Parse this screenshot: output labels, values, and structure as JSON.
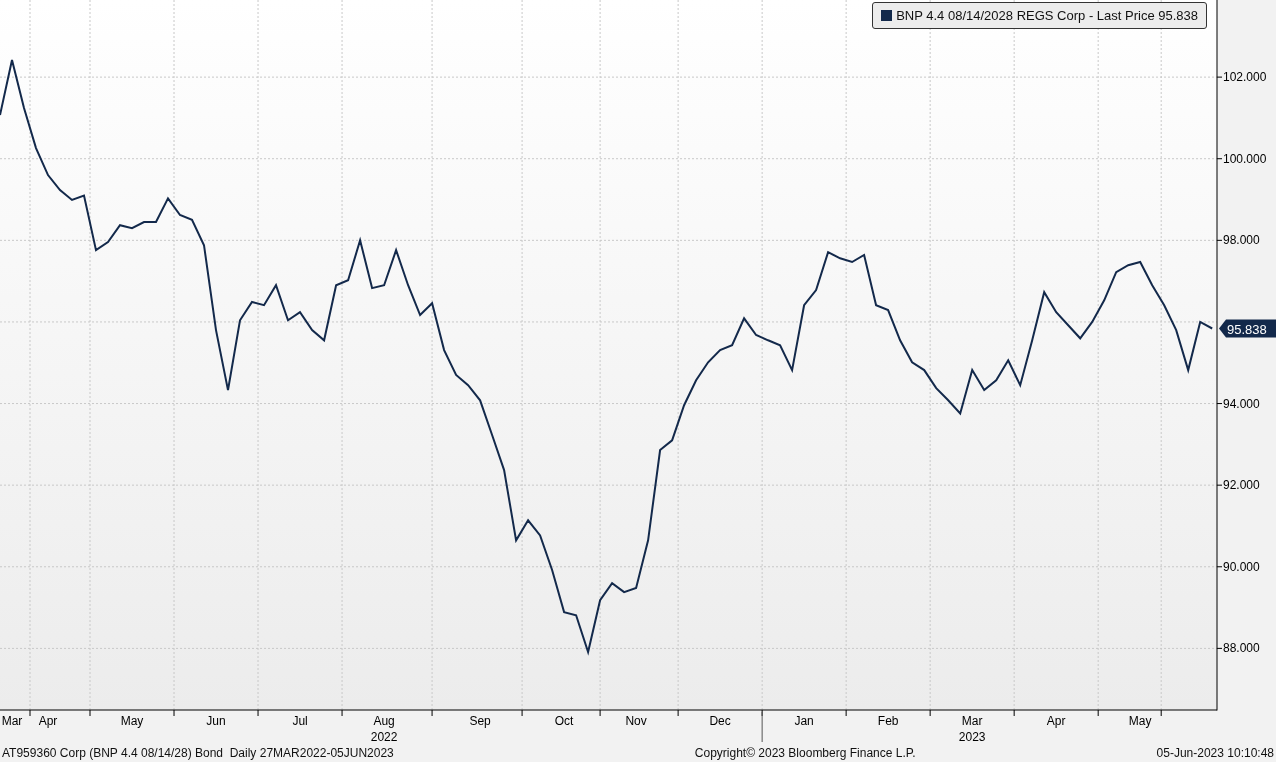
{
  "chart": {
    "last_price": "95.838",
    "year_labels": [
      {
        "label": "2022"
      },
      {
        "label": "2023"
      }
    ],
    "chart_data": {
      "type": "line",
      "grid": true,
      "ylim": [
        86.49,
        103.89
      ],
      "categories": [
        null,
        "Mar",
        null,
        null,
        "Apr",
        null,
        null,
        null,
        null,
        null,
        null,
        "May",
        null,
        null,
        null,
        null,
        null,
        null,
        "Jun",
        null,
        null,
        null,
        null,
        null,
        null,
        "Jul",
        null,
        null,
        null,
        null,
        null,
        null,
        "Aug",
        null,
        null,
        null,
        null,
        null,
        null,
        null,
        "Sep",
        null,
        null,
        null,
        null,
        null,
        null,
        "Oct",
        null,
        null,
        null,
        null,
        null,
        "Nov",
        null,
        null,
        null,
        null,
        null,
        null,
        "Dec",
        null,
        null,
        null,
        null,
        null,
        null,
        "Jan",
        null,
        null,
        null,
        null,
        null,
        null,
        "Feb",
        null,
        null,
        null,
        null,
        null,
        null,
        "Mar",
        null,
        null,
        null,
        null,
        null,
        null,
        "Apr",
        null,
        null,
        null,
        null,
        null,
        null,
        "May",
        null,
        null,
        null,
        null,
        null,
        null
      ],
      "yticks": [
        {
          "value": 88,
          "label": "88.000"
        },
        {
          "value": 90,
          "label": "90.000"
        },
        {
          "value": 92,
          "label": "92.000"
        },
        {
          "value": 94,
          "label": "94.000"
        },
        {
          "value": 98,
          "label": "98.000"
        },
        {
          "value": 100,
          "label": "100.000"
        },
        {
          "value": 102,
          "label": "102.000"
        }
      ],
      "series": [
        {
          "name": "BNP 4.4 08/14/2028 REGS Corp - Last Price 95.838",
          "color": "#13294b",
          "values": [
            101.07,
            102.42,
            101.24,
            100.26,
            99.6,
            99.23,
            98.99,
            99.1,
            97.76,
            97.96,
            98.37,
            98.3,
            98.45,
            98.45,
            99.03,
            98.62,
            98.5,
            97.88,
            95.8,
            94.33,
            96.04,
            96.49,
            96.41,
            96.9,
            96.04,
            96.24,
            95.8,
            95.55,
            96.9,
            97.02,
            98.0,
            96.83,
            96.9,
            97.76,
            96.9,
            96.17,
            96.46,
            95.31,
            94.7,
            94.45,
            94.08,
            93.23,
            92.37,
            90.65,
            91.14,
            90.77,
            89.92,
            88.89,
            88.81,
            87.91,
            89.18,
            89.6,
            89.38,
            89.48,
            90.65,
            92.86,
            93.1,
            93.96,
            94.57,
            95.01,
            95.31,
            95.43,
            96.09,
            95.68,
            95.55,
            95.43,
            94.82,
            96.41,
            96.78,
            97.71,
            97.56,
            97.47,
            97.64,
            96.41,
            96.29,
            95.55,
            95.01,
            94.82,
            94.38,
            94.08,
            93.76,
            94.82,
            94.33,
            94.57,
            95.06,
            94.45,
            95.55,
            96.73,
            96.24,
            95.92,
            95.6,
            96.0,
            96.53,
            97.22,
            97.39,
            97.47,
            96.9,
            96.41,
            95.8,
            94.82,
            96.0,
            95.84
          ]
        }
      ]
    }
  },
  "footer": {
    "left": "AT959360 Corp (BNP 4.4 08/14/28) Bond  Daily 27MAR2022-05JUN2023",
    "center": "Copyright© 2023 Bloomberg Finance L.P.",
    "right": "05-Jun-2023 10:10:48"
  }
}
